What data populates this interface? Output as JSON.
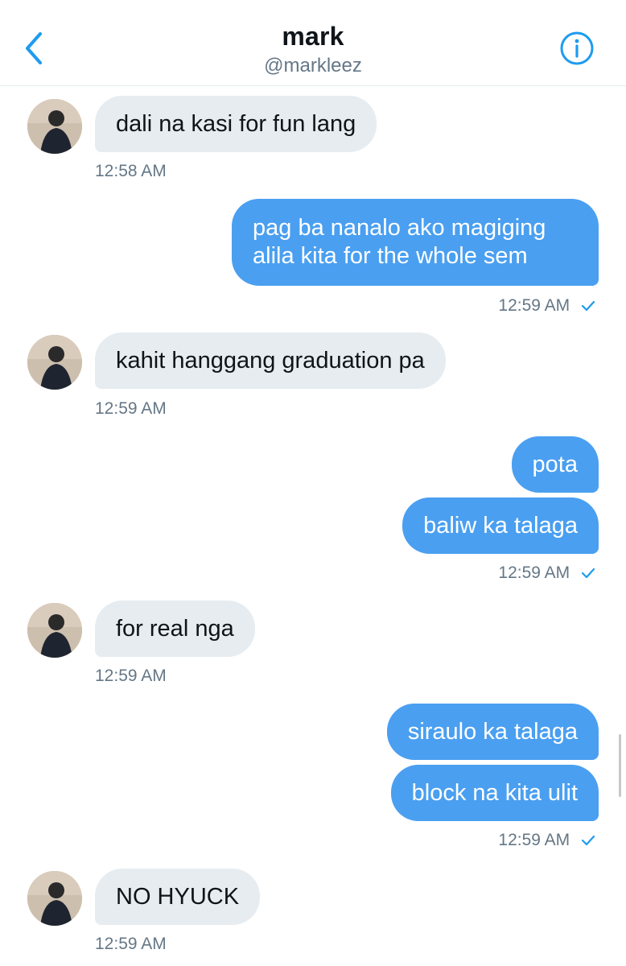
{
  "header": {
    "name": "mark",
    "handle": "@markleez",
    "back_icon": "chevron-left-icon",
    "info_icon": "info-icon",
    "accent": "#1d9bf0"
  },
  "messages": [
    {
      "dir": "in",
      "text": "dali na kasi for fun lang",
      "time": "12:58 AM"
    },
    {
      "dir": "out",
      "text": "pag ba nanalo ako magiging alila kita for the whole sem",
      "time": "12:59 AM"
    },
    {
      "dir": "in",
      "text": "kahit hanggang graduation pa",
      "time": "12:59 AM"
    },
    {
      "dir": "out",
      "text": "pota"
    },
    {
      "dir": "out",
      "text": "baliw ka talaga",
      "time": "12:59 AM"
    },
    {
      "dir": "in",
      "text": "for real nga",
      "time": "12:59 AM"
    },
    {
      "dir": "out",
      "text": "siraulo ka talaga"
    },
    {
      "dir": "out",
      "text": "block na kita ulit",
      "time": "12:59 AM"
    },
    {
      "dir": "in",
      "text": "NO HYUCK",
      "time": "12:59 AM"
    }
  ],
  "colors": {
    "outgoing": "#4a9ff0",
    "incoming": "#e6ecf0",
    "meta": "#657786"
  }
}
